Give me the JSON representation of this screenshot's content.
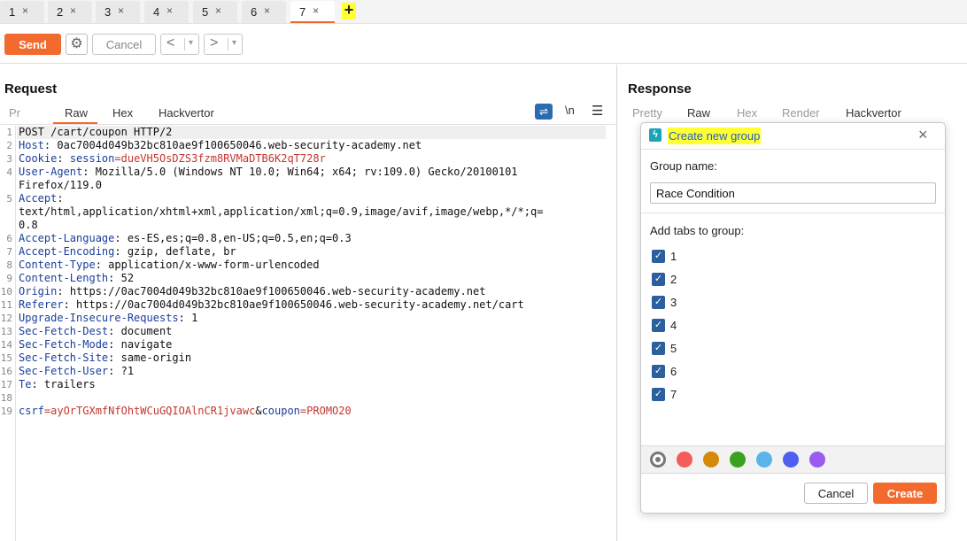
{
  "tabs": [
    {
      "label": "1",
      "close": "×"
    },
    {
      "label": "2",
      "close": "×"
    },
    {
      "label": "3",
      "close": "×"
    },
    {
      "label": "4",
      "close": "×"
    },
    {
      "label": "5",
      "close": "×"
    },
    {
      "label": "6",
      "close": "×"
    },
    {
      "label": "7",
      "close": "×"
    }
  ],
  "active_tab": "7",
  "add_tab_label": "+",
  "toolbar": {
    "send_label": "Send",
    "cancel_label": "Cancel",
    "back_arrow": "<",
    "forward_arrow": ">",
    "dropdown_glyph": "▾"
  },
  "request": {
    "title": "Request",
    "tabs": [
      "Pr",
      "Raw",
      "Hex",
      "Hackvertor"
    ],
    "newline_label": "\\n",
    "menu_glyph": "☰",
    "lines": [
      {
        "n": "1",
        "name": "",
        "sep": "",
        "value": "POST /cart/coupon HTTP/2"
      },
      {
        "n": "2",
        "name": "Host",
        "sep": ": ",
        "value": "0ac7004d049b32bc810ae9f100650046.web-security-academy.net"
      },
      {
        "n": "3",
        "name": "Cookie",
        "sep": ": ",
        "value": "",
        "cookie_key": "session",
        "cookie_val": "=dueVH5OsDZS3fzm8RVMaDTB6K2qT728r"
      },
      {
        "n": "4",
        "name": "User-Agent",
        "sep": ": ",
        "value": "Mozilla/5.0 (Windows NT 10.0; Win64; x64; rv:109.0) Gecko/20100101"
      },
      {
        "n": "",
        "name": "",
        "sep": "",
        "value": "Firefox/119.0"
      },
      {
        "n": "5",
        "name": "Accept",
        "sep": ":",
        "value": ""
      },
      {
        "n": "",
        "name": "",
        "sep": "",
        "value": "text/html,application/xhtml+xml,application/xml;q=0.9,image/avif,image/webp,*/*;q="
      },
      {
        "n": "",
        "name": "",
        "sep": "",
        "value": "0.8"
      },
      {
        "n": "6",
        "name": "Accept-Language",
        "sep": ": ",
        "value": "es-ES,es;q=0.8,en-US;q=0.5,en;q=0.3"
      },
      {
        "n": "7",
        "name": "Accept-Encoding",
        "sep": ": ",
        "value": "gzip, deflate, br"
      },
      {
        "n": "8",
        "name": "Content-Type",
        "sep": ": ",
        "value": "application/x-www-form-urlencoded"
      },
      {
        "n": "9",
        "name": "Content-Length",
        "sep": ": ",
        "value": "52"
      },
      {
        "n": "10",
        "name": "Origin",
        "sep": ": ",
        "value": "https://0ac7004d049b32bc810ae9f100650046.web-security-academy.net"
      },
      {
        "n": "11",
        "name": "Referer",
        "sep": ": ",
        "value": "https://0ac7004d049b32bc810ae9f100650046.web-security-academy.net/cart"
      },
      {
        "n": "12",
        "name": "Upgrade-Insecure-Requests",
        "sep": ": ",
        "value": "1"
      },
      {
        "n": "13",
        "name": "Sec-Fetch-Dest",
        "sep": ": ",
        "value": "document"
      },
      {
        "n": "14",
        "name": "Sec-Fetch-Mode",
        "sep": ": ",
        "value": "navigate"
      },
      {
        "n": "15",
        "name": "Sec-Fetch-Site",
        "sep": ": ",
        "value": "same-origin"
      },
      {
        "n": "16",
        "name": "Sec-Fetch-User",
        "sep": ": ",
        "value": "?1"
      },
      {
        "n": "17",
        "name": "Te",
        "sep": ": ",
        "value": "trailers"
      },
      {
        "n": "18",
        "name": "",
        "sep": "",
        "value": ""
      },
      {
        "n": "19",
        "body": [
          {
            "t": "csrf",
            "c": "ckey"
          },
          {
            "t": "=ayOrTGXmfNfOhtWCuGQIOAlnCR1jvawc",
            "c": "cval"
          },
          {
            "t": "&",
            "c": ""
          },
          {
            "t": "coupon",
            "c": "ckey"
          },
          {
            "t": "=PROMO20",
            "c": "cval"
          }
        ]
      }
    ]
  },
  "response": {
    "title": "Response",
    "tabs": [
      "Pretty",
      "Raw",
      "Hex",
      "Render",
      "Hackvertor"
    ]
  },
  "dialog": {
    "title": "Create new group",
    "close_glyph": "×",
    "group_name_label": "Group name:",
    "group_name_value": "Race Condition",
    "add_tabs_label": "Add tabs to group:",
    "checked_tabs": [
      "1",
      "2",
      "3",
      "4",
      "5",
      "6",
      "7"
    ],
    "check_glyph": "✓",
    "colors": [
      "none",
      "#f45b5b",
      "#d4890a",
      "#3aa21f",
      "#5ab4ea",
      "#4e5ff2",
      "#9a5cf0"
    ],
    "cancel_label": "Cancel",
    "create_label": "Create"
  },
  "colors": {
    "accent": "#f26a2d",
    "highlight": "#ffff33"
  }
}
